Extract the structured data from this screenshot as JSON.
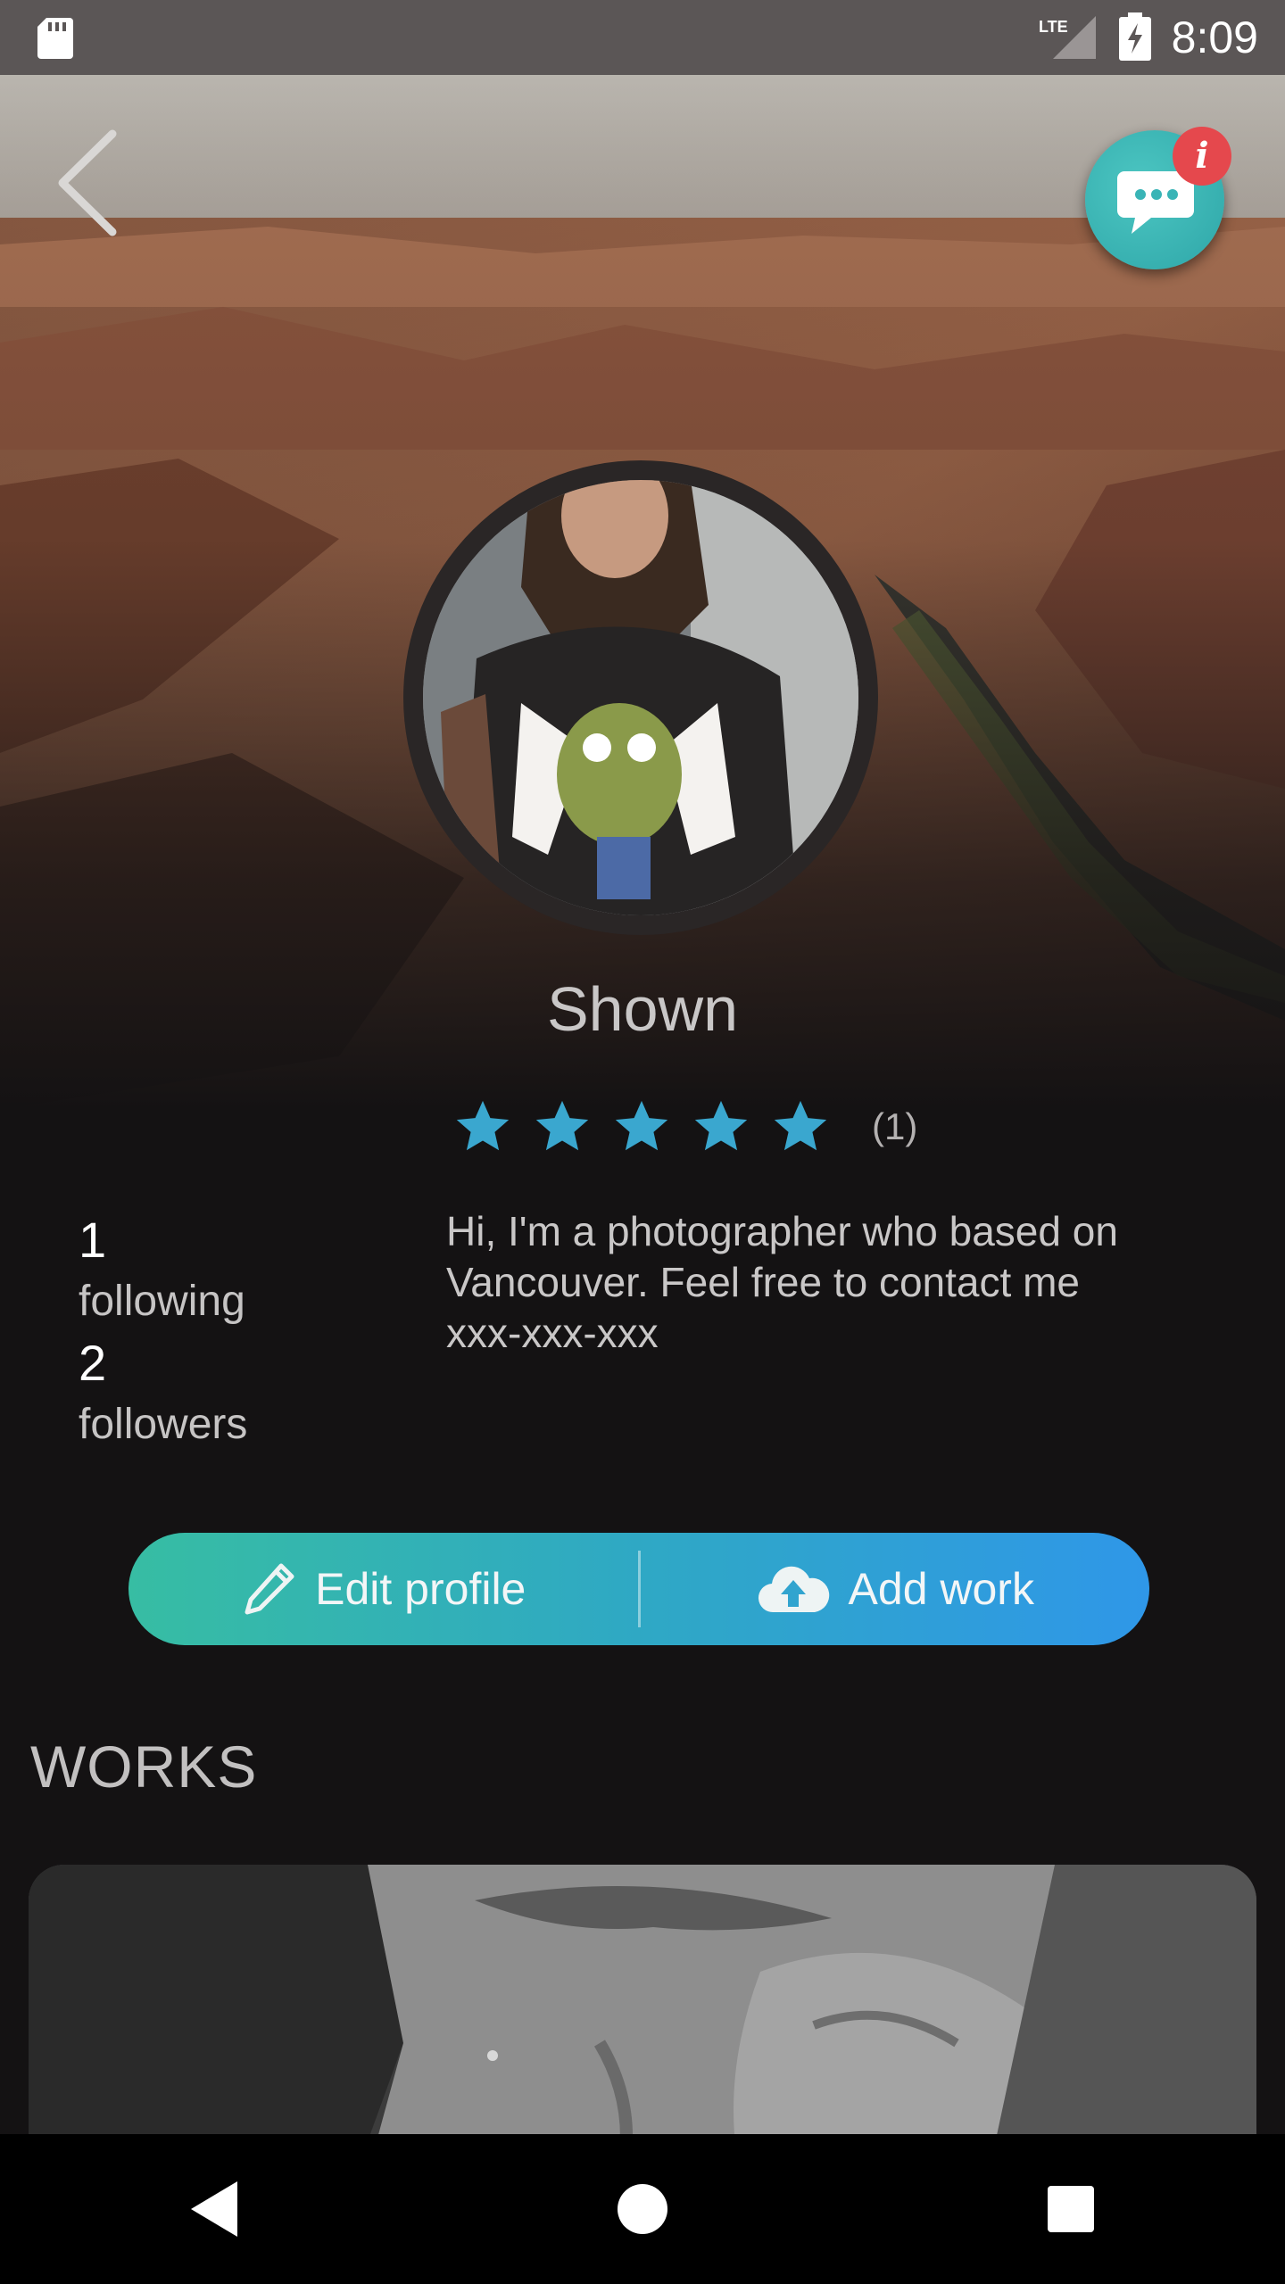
{
  "status_bar": {
    "time": "8:09",
    "network_label": "LTE",
    "icons": [
      "sd-card-icon",
      "lte-signal-icon",
      "battery-charging-icon"
    ]
  },
  "header": {
    "back_icon": "chevron-left-icon",
    "chat_icon": "chat-bubble-icon",
    "badge_text": "i"
  },
  "profile": {
    "name": "Shown",
    "rating": {
      "stars": 5,
      "max": 5,
      "count_label": "(1)"
    },
    "stats": [
      {
        "value": "1",
        "label": "following"
      },
      {
        "value": "2",
        "label": "followers"
      }
    ],
    "bio": "Hi, I'm a photographer who based on Vancouver. Feel free to contact me xxx-xxx-xxx"
  },
  "actions": {
    "edit_label": "Edit profile",
    "edit_icon": "pencil-icon",
    "add_label": "Add work",
    "add_icon": "cloud-upload-icon"
  },
  "works": {
    "title": "WORKS"
  },
  "colors": {
    "accent_teal": "#37bda3",
    "accent_blue": "#2f97e8",
    "star": "#3aa7cf",
    "badge": "#e5484d",
    "background": "#141213"
  },
  "nav": {
    "icons": [
      "nav-back-icon",
      "nav-home-icon",
      "nav-recents-icon"
    ]
  }
}
